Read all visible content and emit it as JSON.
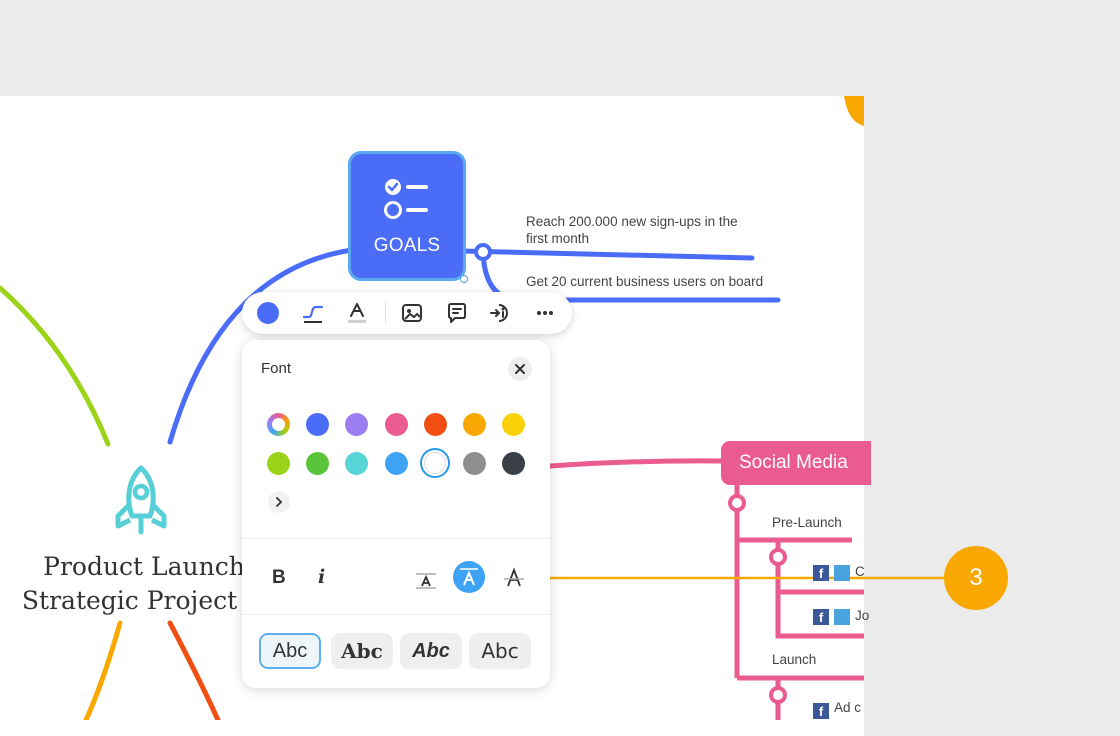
{
  "colors": {
    "background": "#ebebeb",
    "canvas": "#ffffff",
    "goals_branch": "#4a6cf7",
    "social_branch": "#ea5b8f",
    "selection": "#2a9ae8",
    "callout": "#f8a800",
    "green_branch": "#9bd21a",
    "orange_branch": "#f8a800",
    "red_branch": "#f04e12",
    "rocket": "#56cfd6"
  },
  "central_topic": {
    "icon": "rocket-icon",
    "line1": "Product Launch",
    "line2": "Strategic Project #"
  },
  "goals": {
    "label": "GOALS",
    "icon": "checklist-icon",
    "items": [
      {
        "line1": "Reach 200.000 new sign-ups in the",
        "line2": "first month"
      },
      {
        "line1": "Get 20 current business users on board"
      }
    ]
  },
  "toolbar": {
    "items": [
      {
        "name": "topic-color-button",
        "icon": "color-dot-icon"
      },
      {
        "name": "line-style-button",
        "icon": "connector-icon"
      },
      {
        "name": "font-button",
        "icon": "font-color-icon"
      },
      {
        "name": "image-button",
        "icon": "image-icon"
      },
      {
        "name": "comment-button",
        "icon": "comment-icon"
      },
      {
        "name": "insert-info-button",
        "icon": "insert-icon"
      },
      {
        "name": "more-button",
        "icon": "ellipsis-icon"
      }
    ]
  },
  "font_panel": {
    "title": "Font",
    "close_icon": "close-icon",
    "color_rows": [
      [
        "rainbow",
        "#4a6cf7",
        "#9d7ef0",
        "#ea5b8f",
        "#f04e12",
        "#f8a800",
        "#f9d20a"
      ],
      [
        "#9bd21a",
        "#5ac43b",
        "#56d4d6",
        "#3ea3f5",
        "#ffffff",
        "#8e8e8e",
        "#3a3f46"
      ]
    ],
    "selected_color": "#ffffff",
    "more_colors_icon": "chevron-right-icon",
    "bold_label": "B",
    "italic_label": "i",
    "align_options": [
      "text-position-bottom-icon",
      "text-position-middle-icon",
      "text-position-top-icon"
    ],
    "active_align_index": 1,
    "presets": [
      "Abc",
      "Abc",
      "Abc",
      "Abc"
    ],
    "selected_preset_index": 0
  },
  "social_media": {
    "label": "Social Media",
    "branches": [
      {
        "label": "Pre-Launch",
        "leaves": [
          "C",
          "Jo"
        ]
      },
      {
        "label": "Launch",
        "leaves": [
          "Ad c"
        ]
      }
    ]
  },
  "callout": {
    "number": "3"
  }
}
